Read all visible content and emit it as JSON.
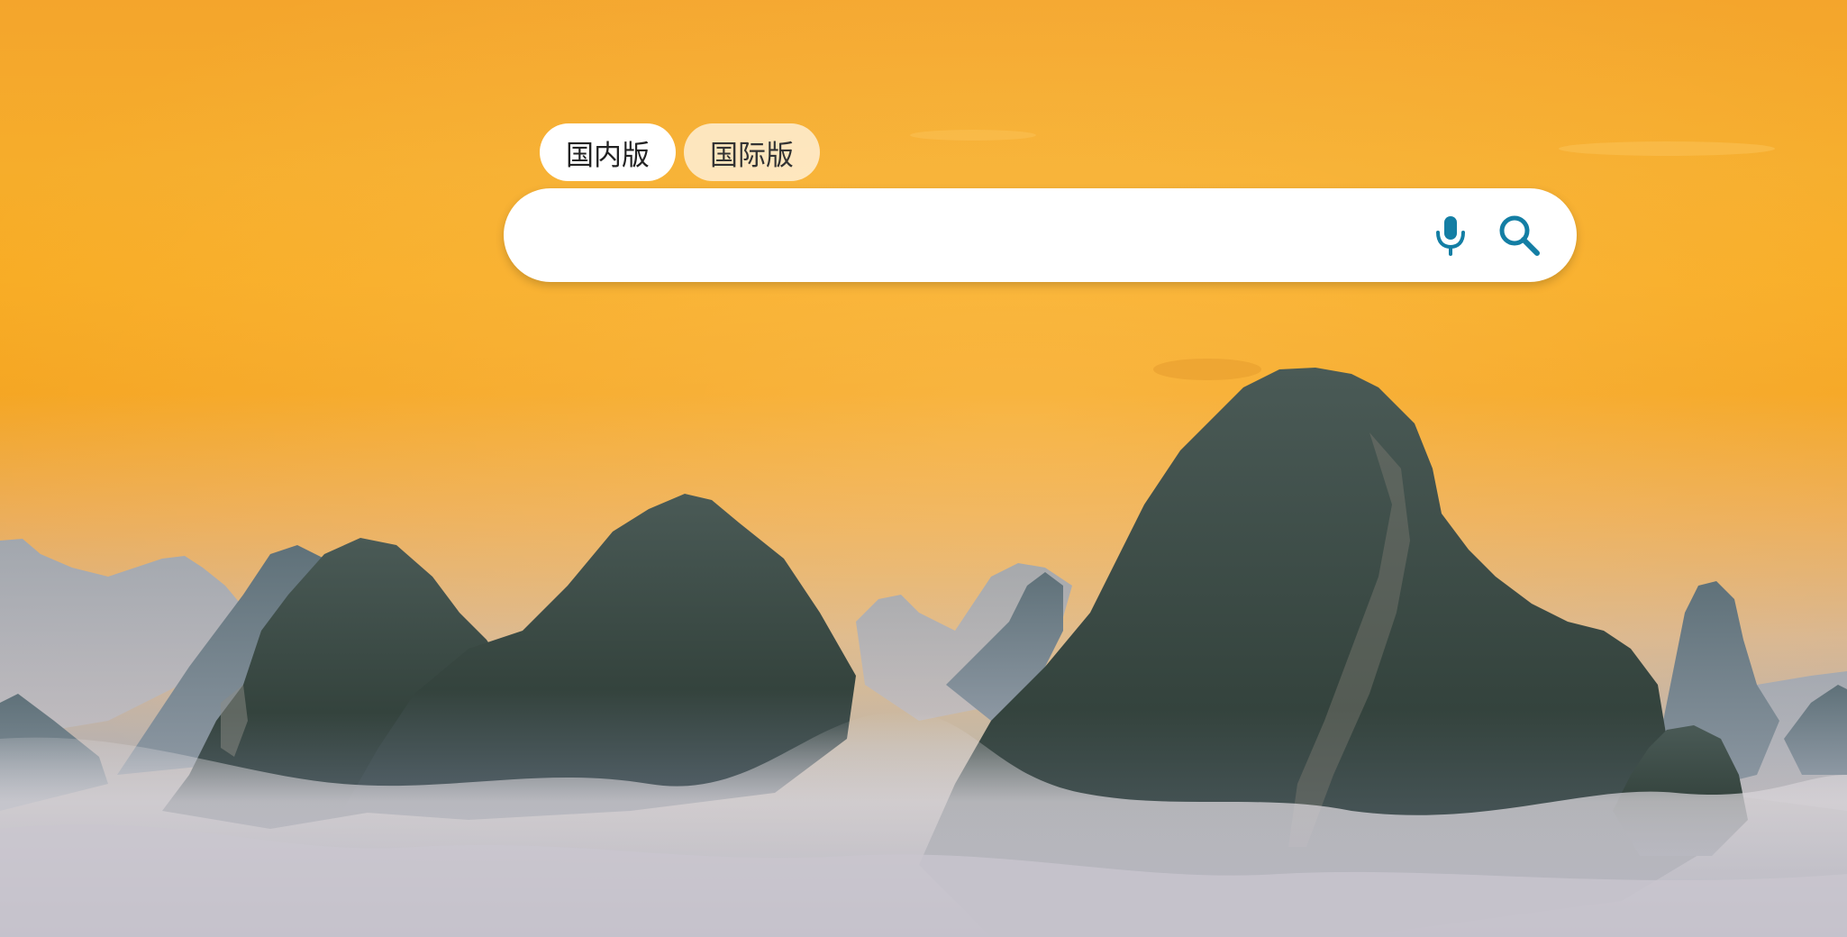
{
  "tabs": [
    {
      "label": "国内版",
      "active": true
    },
    {
      "label": "国际版",
      "active": false
    }
  ],
  "search": {
    "value": "",
    "placeholder": ""
  },
  "icons": {
    "mic": "microphone-icon",
    "search": "search-icon"
  },
  "colors": {
    "accent": "#137ea4",
    "sky": "#f6a823"
  }
}
